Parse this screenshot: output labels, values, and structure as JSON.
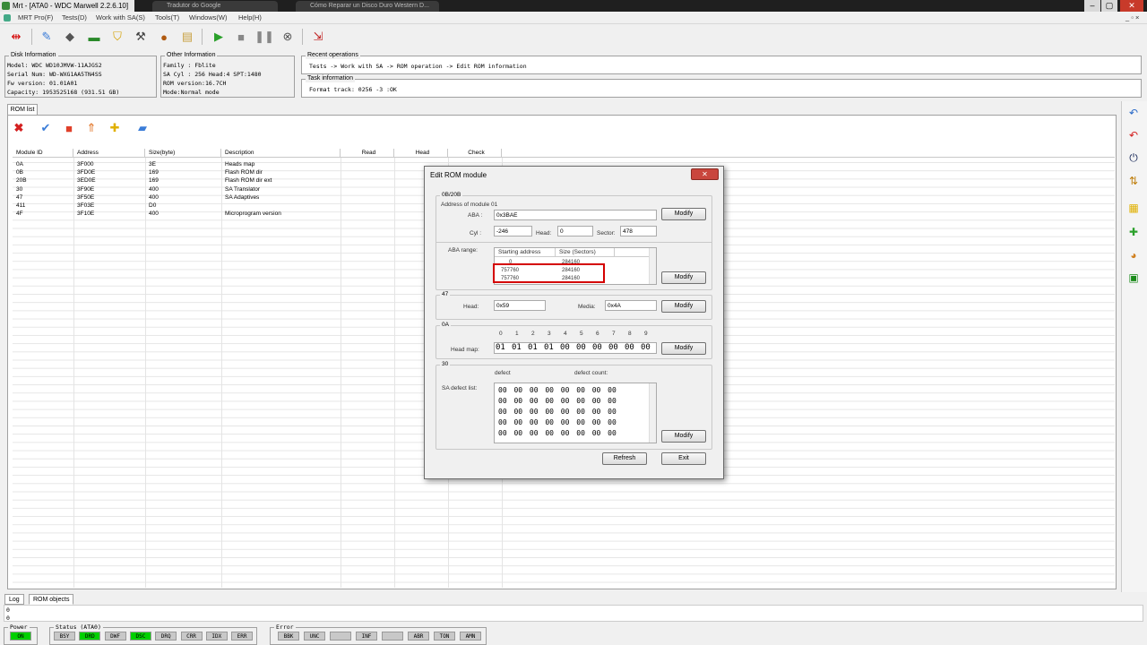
{
  "window": {
    "title": "Mrt - [ATA0 - WDC Marwell 2.2.6.10]",
    "ghost_tab_1": "Tradutor do Google",
    "ghost_tab_2": "Cómo Reparar un Disco Duro Western D...",
    "min": "–",
    "max": "▢",
    "close": "✕"
  },
  "menu": [
    "MRT Pro(F)",
    "Tests(D)",
    "Work with SA(S)",
    "Tools(T)",
    "Windows(W)",
    "Help(H)"
  ],
  "menu_right": "_ ▫ ×",
  "disk_info": {
    "legend": "Disk Information",
    "model": "   Model: WDC WD10JMVW-11AJGS2",
    "serial": "Serial Num: WD-WXG1AA5TN4SS",
    "fw": "Fw version: 01.01A01",
    "capacity": "  Capacity: 1953525168 (931.51 GB)"
  },
  "other_info": {
    "legend": "Other Information",
    "family": "Family  : Fblite",
    "sa": "SA Cyl  : 256   Head:4   SPT:1480",
    "rom": "ROM version:16.7CH",
    "mode": "Mode:Normal mode"
  },
  "recent_ops": {
    "legend": "Recent operations",
    "text": "Tests -> Work with SA -> ROM operation -> Edit ROM information"
  },
  "task_info": {
    "legend": "Task information",
    "text": "Format track: 0256 -3           :OK"
  },
  "rom_tab": "ROM list",
  "columns": [
    "Module ID",
    "Address",
    "Size(byte)",
    "Description",
    "Read",
    "Head",
    "Check"
  ],
  "rows": [
    [
      "0A",
      "3F000",
      "3E",
      "Heads map"
    ],
    [
      "0B",
      "3FD0E",
      "169",
      "Flash ROM dir"
    ],
    [
      "20B",
      "3ED0E",
      "169",
      "Flash ROM dir ext"
    ],
    [
      "30",
      "3F90E",
      "400",
      "SA Translator"
    ],
    [
      "47",
      "3F50E",
      "400",
      "SA Adaptives"
    ],
    [
      "411",
      "3F03E",
      "D0",
      ""
    ],
    [
      "4F",
      "3F10E",
      "400",
      "Microprogram version"
    ]
  ],
  "bottom_tabs": [
    "Log",
    "ROM objects"
  ],
  "log_lines": [
    "0",
    "0"
  ],
  "status": {
    "power_legend": "Power",
    "power": "ON",
    "status_legend": "Status (ATA0)",
    "flags": [
      "BSY",
      "DRD",
      "DWF",
      "DSC",
      "DRQ",
      "CRR",
      "IDX",
      "ERR"
    ],
    "error_legend": "Error",
    "errors": [
      "BBK",
      "UNC",
      "",
      "INF",
      "",
      "ABR",
      "TON",
      "AMN"
    ]
  },
  "dialog": {
    "title": "Edit ROM module",
    "close": "✕",
    "g1_legend": "0B/20B",
    "addr_label": "Address of module 01",
    "aba_label": "ABA :",
    "aba": "0x3BAE",
    "cyl_label": "Cyl :",
    "cyl": "-246",
    "head_label": "Head:",
    "head": "0",
    "sector_label": "Sector:",
    "sector": "478",
    "modify": "Modify",
    "aba_range_label": "ABA range:",
    "list_cols": [
      "Starting address",
      "Size (Sectors)"
    ],
    "list_rows": [
      [
        "0",
        "284160"
      ],
      [
        "757760",
        "284160"
      ],
      [
        "757760",
        "284160"
      ]
    ],
    "g47_legend": "47",
    "head47_label": "Head:",
    "head47": "0x59",
    "media_label": "Media:",
    "media": "0x4A",
    "g0a_legend": "0A",
    "headmap_idx": [
      "0",
      "1",
      "2",
      "3",
      "4",
      "5",
      "6",
      "7",
      "8",
      "9"
    ],
    "headmap_label": "Head map:",
    "headmap": [
      "01",
      "01",
      "01",
      "01",
      "00",
      "00",
      "00",
      "00",
      "00",
      "00"
    ],
    "g30_legend": "30",
    "defect_label": "defect",
    "defect_count_label": "defect count:",
    "sa_defect_label": "SA defect list:",
    "defect_rows": [
      "00 00 00 00 00 00 00 00",
      "00 00 00 00 00 00 00 00",
      "00 00 00 00 00 00 00 00",
      "00 00 00 00 00 00 00 00",
      "00 00 00 00 00 00 00 00"
    ],
    "refresh": "Refresh",
    "exit": "Exit"
  },
  "colors": {
    "accent_red": "#d40000",
    "status_on": "#00d000"
  }
}
